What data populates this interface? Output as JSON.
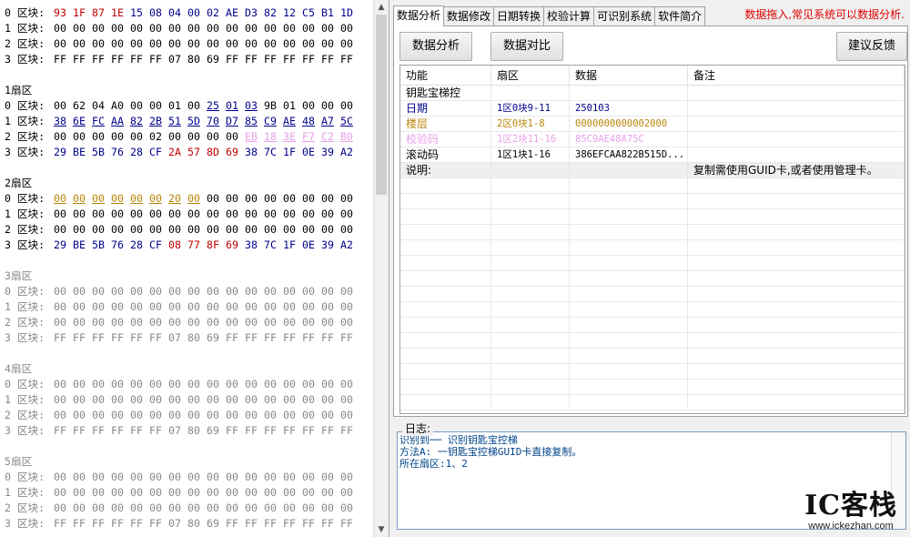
{
  "hex_view": {
    "sectors": [
      {
        "title": "",
        "state": "active",
        "blocks": [
          {
            "label": "0 区块:",
            "bytes": [
              "93",
              "1F",
              "87",
              "1E",
              "15",
              "08",
              "04",
              "00",
              "02",
              "AE",
              "D3",
              "82",
              "12",
              "C5",
              "B1",
              "1D"
            ],
            "colors": [
              "red",
              "red",
              "red",
              "red",
              "blue",
              "blue",
              "blue",
              "blue",
              "blue",
              "blue",
              "blue",
              "blue",
              "blue",
              "blue",
              "blue",
              "blue"
            ]
          },
          {
            "label": "1 区块:",
            "bytes": [
              "00",
              "00",
              "00",
              "00",
              "00",
              "00",
              "00",
              "00",
              "00",
              "00",
              "00",
              "00",
              "00",
              "00",
              "00",
              "00"
            ]
          },
          {
            "label": "2 区块:",
            "bytes": [
              "00",
              "00",
              "00",
              "00",
              "00",
              "00",
              "00",
              "00",
              "00",
              "00",
              "00",
              "00",
              "00",
              "00",
              "00",
              "00"
            ]
          },
          {
            "label": "3 区块:",
            "bytes": [
              "FF",
              "FF",
              "FF",
              "FF",
              "FF",
              "FF",
              "07",
              "80",
              "69",
              "FF",
              "FF",
              "FF",
              "FF",
              "FF",
              "FF",
              "FF"
            ]
          }
        ]
      },
      {
        "title": "1扇区",
        "state": "active",
        "blocks": [
          {
            "label": "0 区块:",
            "bytes": [
              "00",
              "62",
              "04",
              "A0",
              "00",
              "00",
              "01",
              "00",
              "25",
              "01",
              "03",
              "9B",
              "01",
              "00",
              "00",
              "00"
            ],
            "colors": [
              "",
              "",
              "",
              "",
              "",
              "",
              "",
              "",
              "ul-blue",
              "ul-blue",
              "ul-blue",
              "",
              "",
              "",
              "",
              ""
            ]
          },
          {
            "label": "1 区块:",
            "bytes": [
              "38",
              "6E",
              "FC",
              "AA",
              "82",
              "2B",
              "51",
              "5D",
              "70",
              "D7",
              "85",
              "C9",
              "AE",
              "48",
              "A7",
              "5C"
            ],
            "colors": [
              "ul",
              "ul",
              "ul",
              "ul",
              "ul",
              "ul",
              "ul",
              "ul",
              "ul",
              "ul",
              "ul",
              "ul",
              "ul",
              "ul",
              "ul",
              "ul"
            ]
          },
          {
            "label": "2 区块:",
            "bytes": [
              "00",
              "00",
              "00",
              "00",
              "00",
              "02",
              "00",
              "00",
              "00",
              "00",
              "EB",
              "18",
              "3E",
              "F7",
              "C2",
              "B0"
            ],
            "colors": [
              "",
              "",
              "",
              "",
              "",
              "",
              "",
              "",
              "",
              "",
              "ul-pink",
              "ul-pink",
              "ul-pink",
              "ul-pink",
              "ul-pink",
              "ul-pink"
            ]
          },
          {
            "label": "3 区块:",
            "bytes": [
              "29",
              "BE",
              "5B",
              "76",
              "28",
              "CF",
              "2A",
              "57",
              "8D",
              "69",
              "38",
              "7C",
              "1F",
              "0E",
              "39",
              "A2"
            ],
            "colors": [
              "blue",
              "blue",
              "blue",
              "blue",
              "blue",
              "blue",
              "red",
              "red",
              "red",
              "red",
              "blue",
              "blue",
              "blue",
              "blue",
              "blue",
              "blue"
            ]
          }
        ]
      },
      {
        "title": "2扇区",
        "state": "active",
        "blocks": [
          {
            "label": "0 区块:",
            "bytes": [
              "00",
              "00",
              "00",
              "00",
              "00",
              "00",
              "20",
              "00",
              "00",
              "00",
              "00",
              "00",
              "00",
              "00",
              "00",
              "00"
            ],
            "colors": [
              "ul-gold",
              "ul-gold",
              "ul-gold",
              "ul-gold",
              "ul-gold",
              "ul-gold",
              "ul-gold",
              "ul-gold",
              "",
              "",
              "",
              "",
              "",
              "",
              "",
              ""
            ]
          },
          {
            "label": "1 区块:",
            "bytes": [
              "00",
              "00",
              "00",
              "00",
              "00",
              "00",
              "00",
              "00",
              "00",
              "00",
              "00",
              "00",
              "00",
              "00",
              "00",
              "00"
            ]
          },
          {
            "label": "2 区块:",
            "bytes": [
              "00",
              "00",
              "00",
              "00",
              "00",
              "00",
              "00",
              "00",
              "00",
              "00",
              "00",
              "00",
              "00",
              "00",
              "00",
              "00"
            ]
          },
          {
            "label": "3 区块:",
            "bytes": [
              "29",
              "BE",
              "5B",
              "76",
              "28",
              "CF",
              "08",
              "77",
              "8F",
              "69",
              "38",
              "7C",
              "1F",
              "0E",
              "39",
              "A2"
            ],
            "colors": [
              "blue",
              "blue",
              "blue",
              "blue",
              "blue",
              "blue",
              "red",
              "red",
              "red",
              "red",
              "blue",
              "blue",
              "blue",
              "blue",
              "blue",
              "blue"
            ]
          }
        ]
      },
      {
        "title": "3扇区",
        "state": "gray",
        "blocks": [
          {
            "label": "0 区块:",
            "bytes": [
              "00",
              "00",
              "00",
              "00",
              "00",
              "00",
              "00",
              "00",
              "00",
              "00",
              "00",
              "00",
              "00",
              "00",
              "00",
              "00"
            ]
          },
          {
            "label": "1 区块:",
            "bytes": [
              "00",
              "00",
              "00",
              "00",
              "00",
              "00",
              "00",
              "00",
              "00",
              "00",
              "00",
              "00",
              "00",
              "00",
              "00",
              "00"
            ]
          },
          {
            "label": "2 区块:",
            "bytes": [
              "00",
              "00",
              "00",
              "00",
              "00",
              "00",
              "00",
              "00",
              "00",
              "00",
              "00",
              "00",
              "00",
              "00",
              "00",
              "00"
            ]
          },
          {
            "label": "3 区块:",
            "bytes": [
              "FF",
              "FF",
              "FF",
              "FF",
              "FF",
              "FF",
              "07",
              "80",
              "69",
              "FF",
              "FF",
              "FF",
              "FF",
              "FF",
              "FF",
              "FF"
            ]
          }
        ]
      },
      {
        "title": "4扇区",
        "state": "gray",
        "blocks": [
          {
            "label": "0 区块:",
            "bytes": [
              "00",
              "00",
              "00",
              "00",
              "00",
              "00",
              "00",
              "00",
              "00",
              "00",
              "00",
              "00",
              "00",
              "00",
              "00",
              "00"
            ]
          },
          {
            "label": "1 区块:",
            "bytes": [
              "00",
              "00",
              "00",
              "00",
              "00",
              "00",
              "00",
              "00",
              "00",
              "00",
              "00",
              "00",
              "00",
              "00",
              "00",
              "00"
            ]
          },
          {
            "label": "2 区块:",
            "bytes": [
              "00",
              "00",
              "00",
              "00",
              "00",
              "00",
              "00",
              "00",
              "00",
              "00",
              "00",
              "00",
              "00",
              "00",
              "00",
              "00"
            ]
          },
          {
            "label": "3 区块:",
            "bytes": [
              "FF",
              "FF",
              "FF",
              "FF",
              "FF",
              "FF",
              "07",
              "80",
              "69",
              "FF",
              "FF",
              "FF",
              "FF",
              "FF",
              "FF",
              "FF"
            ]
          }
        ]
      },
      {
        "title": "5扇区",
        "state": "gray",
        "blocks": [
          {
            "label": "0 区块:",
            "bytes": [
              "00",
              "00",
              "00",
              "00",
              "00",
              "00",
              "00",
              "00",
              "00",
              "00",
              "00",
              "00",
              "00",
              "00",
              "00",
              "00"
            ]
          },
          {
            "label": "1 区块:",
            "bytes": [
              "00",
              "00",
              "00",
              "00",
              "00",
              "00",
              "00",
              "00",
              "00",
              "00",
              "00",
              "00",
              "00",
              "00",
              "00",
              "00"
            ]
          },
          {
            "label": "2 区块:",
            "bytes": [
              "00",
              "00",
              "00",
              "00",
              "00",
              "00",
              "00",
              "00",
              "00",
              "00",
              "00",
              "00",
              "00",
              "00",
              "00",
              "00"
            ]
          },
          {
            "label": "3 区块:",
            "bytes": [
              "FF",
              "FF",
              "FF",
              "FF",
              "FF",
              "FF",
              "07",
              "80",
              "69",
              "FF",
              "FF",
              "FF",
              "FF",
              "FF",
              "FF",
              "FF"
            ]
          }
        ]
      }
    ]
  },
  "tabs": [
    "数据分析",
    "数据修改",
    "日期转换",
    "校验计算",
    "可识别系统",
    "软件简介"
  ],
  "hint": "数据拖入,常见系统可以数据分析.",
  "buttons": {
    "analyze": "数据分析",
    "compare": "数据对比",
    "feedback": "建议反馈"
  },
  "grid": {
    "headers": [
      "功能",
      "扇区",
      "数据",
      "备注"
    ],
    "rows": [
      {
        "cells": [
          "钥匙宝梯控",
          "",
          "",
          ""
        ],
        "color": "#000000"
      },
      {
        "cells": [
          "日期",
          "1区0块9-11",
          "250103",
          ""
        ],
        "color": "#00008b"
      },
      {
        "cells": [
          "楼层",
          "2区0块1-8",
          "0000000000002000",
          ""
        ],
        "color": "#b8860b"
      },
      {
        "cells": [
          "校验码",
          "1区2块11-16",
          "85C9AE48A75C",
          ""
        ],
        "color": "#e8a0e8"
      },
      {
        "cells": [
          "滚动码",
          "1区1块1-16",
          "386EFCAA822B515D...",
          ""
        ],
        "color": "#000000"
      },
      {
        "cells": [
          "说明:",
          "",
          "",
          "复制需使用GUID卡,或者使用管理卡。"
        ],
        "color": "#000000",
        "selected": true
      }
    ]
  },
  "log": {
    "label": "日志:",
    "lines": [
      "识别到── 识别钥匙宝控梯",
      "方法A: 一钥匙宝控梯GUID卡直接复制。",
      "所在扇区:1、2"
    ]
  },
  "brand": {
    "name": "IC客栈",
    "url": "www.ickezhan.com"
  },
  "colors": {
    "red": "#c00000",
    "blue": "#00008b",
    "gold": "#b8860b",
    "pink": "#e8a0e8",
    "gray": "#888888"
  }
}
